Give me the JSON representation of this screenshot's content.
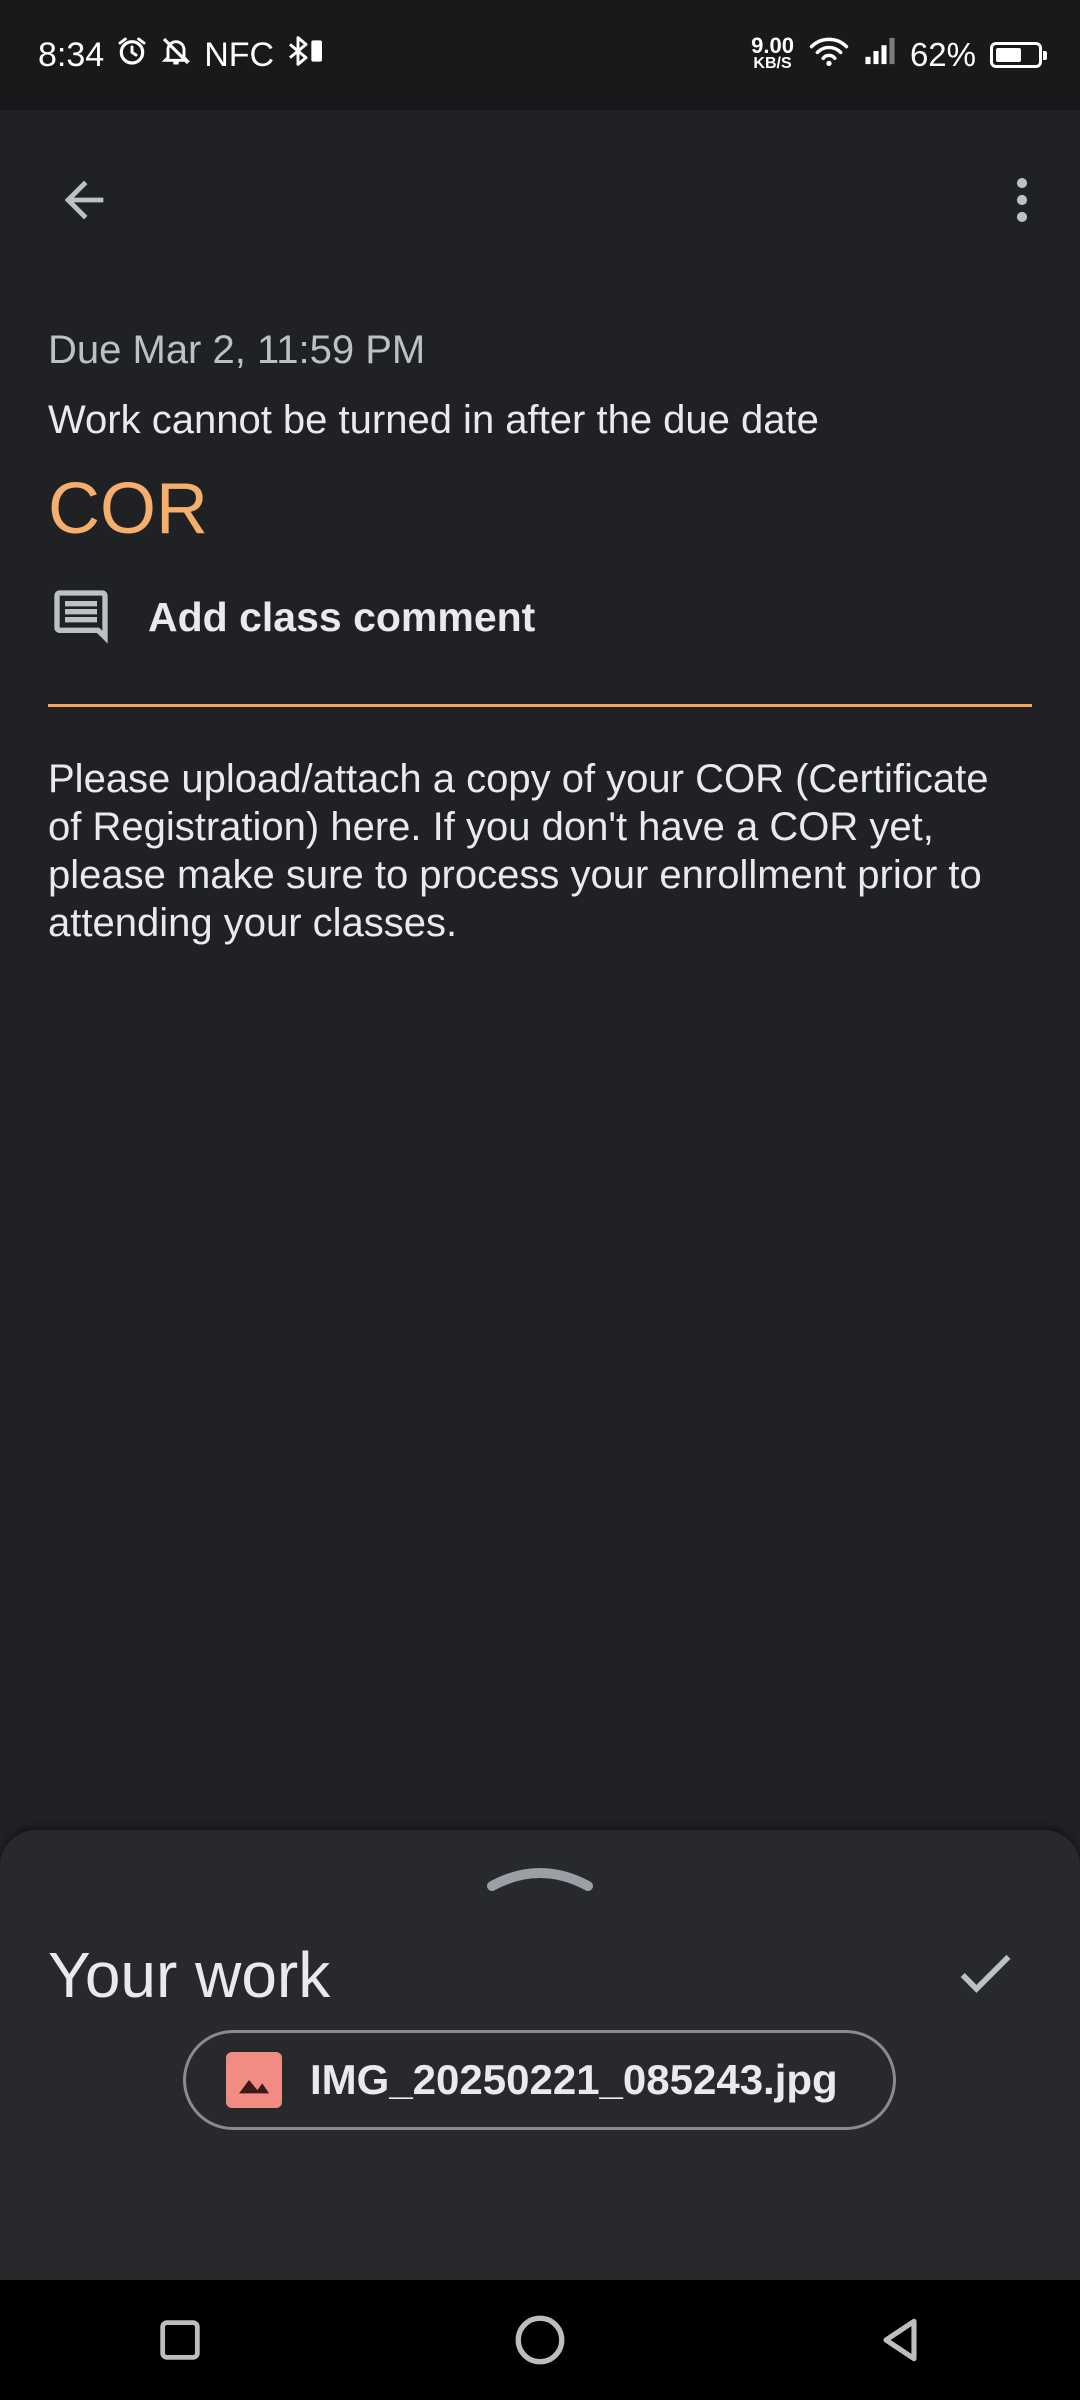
{
  "status_bar": {
    "time": "8:34",
    "nfc": "NFC",
    "net_speed_value": "9.00",
    "net_speed_unit": "KB/S",
    "battery": "62%",
    "battery_level": 0.62,
    "icons": [
      "alarm-icon",
      "mute-icon",
      "bluetooth-icon",
      "wifi-icon",
      "signal-icon",
      "battery-icon"
    ]
  },
  "toolbar": {
    "back_icon": "arrow-back-icon",
    "more_icon": "more-vert-icon"
  },
  "assignment": {
    "due": "Due Mar 2, 11:59 PM",
    "late_note": "Work cannot be turned in after the due date",
    "title": "COR",
    "comment_label": "Add class comment",
    "description": "Please upload/attach a copy of your COR (Certificate of Registration) here. If you don't have a COR yet, please make sure to process your enrollment prior to attending your classes."
  },
  "your_work": {
    "title": "Your work",
    "attachment_name": "IMG_20250221_085243.jpg"
  },
  "colors": {
    "background": "#202124",
    "accent": "#f6ae6c",
    "divider": "#f2a65a",
    "sheet": "#28292c",
    "file_icon": "#f28b82"
  }
}
